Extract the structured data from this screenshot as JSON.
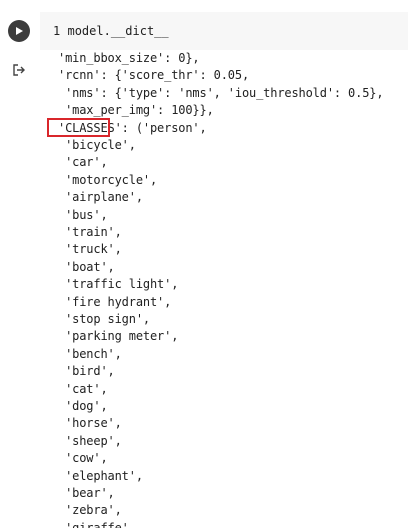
{
  "cell": {
    "line_number": "1",
    "code": "model.__dict__"
  },
  "output": {
    "lines": [
      "'min_bbox_size': 0},",
      "'rcnn': {'score_thr': 0.05,",
      " 'nms': {'type': 'nms', 'iou_threshold': 0.5},",
      " 'max_per_img': 100}},",
      "'CLASSES': ('person',",
      " 'bicycle',",
      " 'car',",
      " 'motorcycle',",
      " 'airplane',",
      " 'bus',",
      " 'train',",
      " 'truck',",
      " 'boat',",
      " 'traffic light',",
      " 'fire hydrant',",
      " 'stop sign',",
      " 'parking meter',",
      " 'bench',",
      " 'bird',",
      " 'cat',",
      " 'dog',",
      " 'horse',",
      " 'sheep',",
      " 'cow',",
      " 'elephant',",
      " 'bear',",
      " 'zebra',",
      " 'giraffe',"
    ]
  },
  "annotation": {
    "highlighted_text": "'CLASSES'",
    "color": "#d9262b"
  },
  "icons": {
    "run": "play-icon",
    "output": "output-redirect-icon"
  }
}
